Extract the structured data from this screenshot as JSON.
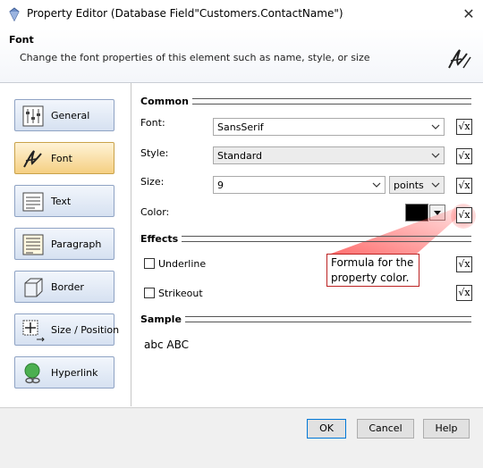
{
  "window": {
    "title": "Property Editor (Database Field\"Customers.ContactName\")"
  },
  "header": {
    "title": "Font",
    "description": "Change the font properties of this element such as name, style, or size"
  },
  "nav": {
    "items": [
      {
        "label": "General",
        "icon": "sliders-icon"
      },
      {
        "label": "Font",
        "icon": "font-icon",
        "active": true
      },
      {
        "label": "Text",
        "icon": "text-icon"
      },
      {
        "label": "Paragraph",
        "icon": "paragraph-icon"
      },
      {
        "label": "Border",
        "icon": "border-icon"
      },
      {
        "label": "Size / Position",
        "icon": "size-position-icon"
      },
      {
        "label": "Hyperlink",
        "icon": "hyperlink-icon"
      }
    ]
  },
  "common": {
    "title": "Common",
    "font_label": "Font:",
    "font_value": "SansSerif",
    "style_label": "Style:",
    "style_value": "Standard",
    "size_label": "Size:",
    "size_value": "9",
    "size_unit": "points",
    "color_label": "Color:",
    "color_value": "#000000"
  },
  "effects": {
    "title": "Effects",
    "underline_label": "Underline",
    "strikeout_label": "Strikeout"
  },
  "sample": {
    "title": "Sample",
    "text": "abc ABC"
  },
  "formula_button": {
    "label": "√x"
  },
  "tooltip": {
    "text": "Formula for the property color."
  },
  "buttons": {
    "ok": "OK",
    "cancel": "Cancel",
    "help": "Help"
  },
  "colors": {
    "accent": "#0078d7",
    "highlight": "#e04040"
  }
}
